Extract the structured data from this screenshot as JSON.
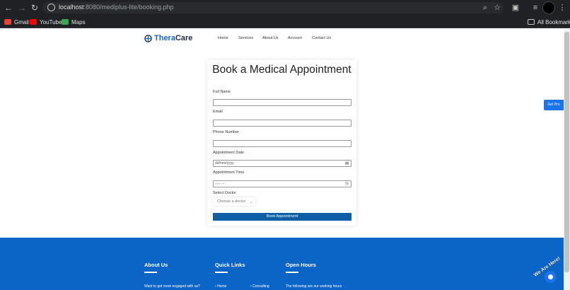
{
  "browser": {
    "url_host": "localhost",
    "url_rest": ":8080/mediplus-lite/booking.php"
  },
  "bookmarks": [
    {
      "label": "Gmail",
      "color": "#ea4335"
    },
    {
      "label": "YouTube",
      "color": "#ff0000"
    },
    {
      "label": "Maps",
      "color": "#34a853"
    }
  ],
  "all_bookmarks_label": "All Bookmarks",
  "site": {
    "logo_part1": "Thera",
    "logo_part2": "Care",
    "nav": [
      "Home",
      "Services",
      "About Us",
      "Account",
      "Contact Us"
    ]
  },
  "form": {
    "title": "Book a Medical Appointment",
    "fields": {
      "full_name": "Full Name",
      "email": "Email",
      "phone": "Phone Number",
      "date": "Appointment Date",
      "date_placeholder": "dd/mm/yyyy",
      "time": "Appointment Time",
      "time_placeholder": "--:-- --",
      "doctor": "Select Doctor",
      "doctor_placeholder": "Choose a doctor"
    },
    "submit": "Book Appointment"
  },
  "get_pro": "Get Pro",
  "footer": {
    "about_title": "About Us",
    "about_text": "Want to get more engaged with us?",
    "links_title": "Quick Links",
    "link_1": "Home",
    "link_2": "Consulting",
    "hours_title": "Open Hours",
    "hours_text": "The following are our working hours"
  },
  "chat_label": "We Are Here!",
  "colors": {
    "accent": "#1565c0",
    "footer": "#0b65c6",
    "button": "#0d5ea6"
  }
}
